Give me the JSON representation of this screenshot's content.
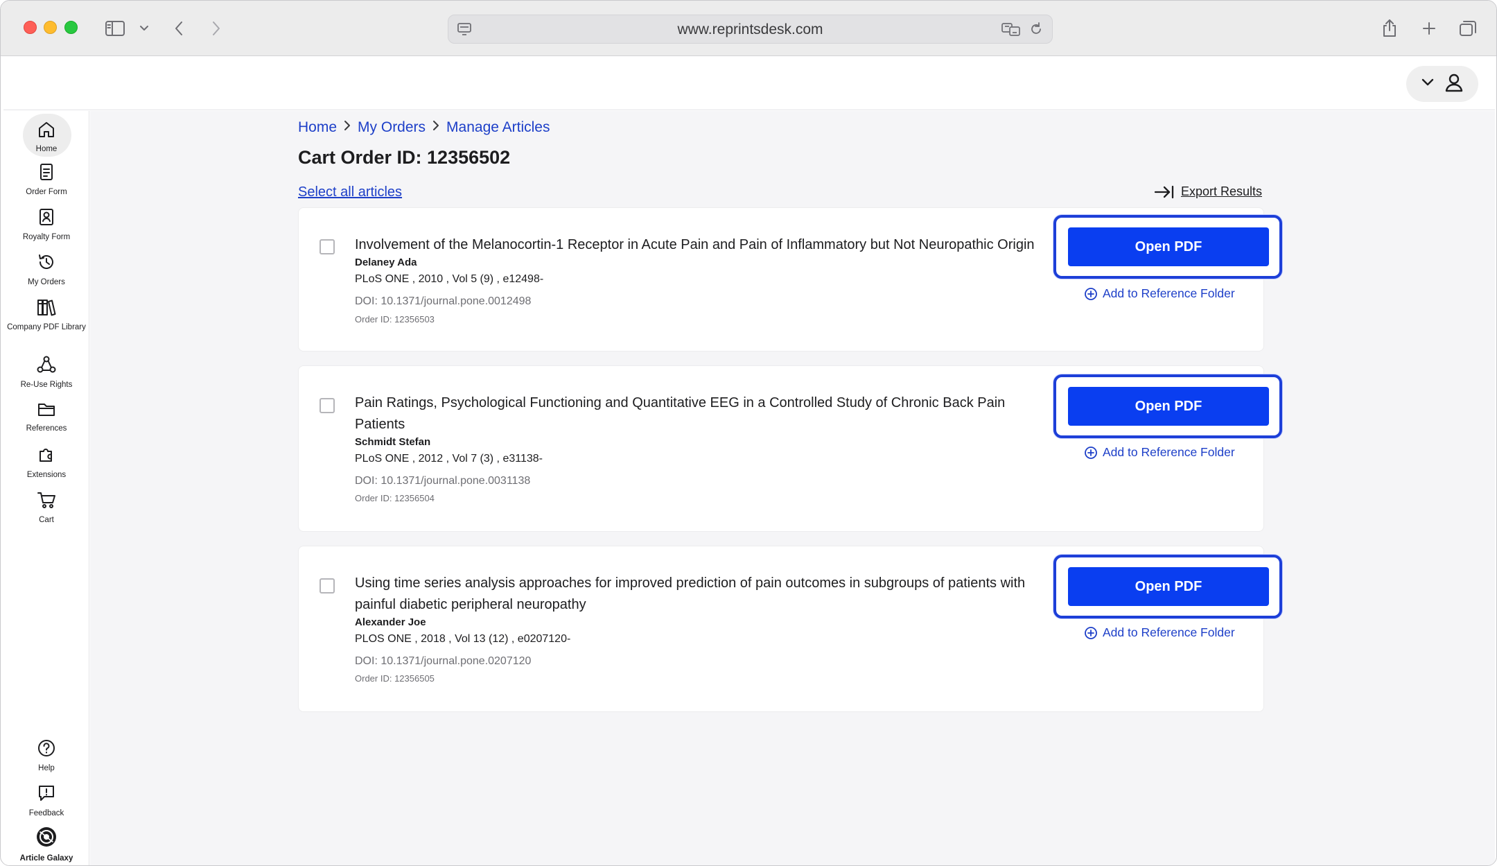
{
  "browser": {
    "url": "www.reprintsdesk.com"
  },
  "sidebar": {
    "items": [
      {
        "label": "Home",
        "icon": "home-icon"
      },
      {
        "label": "Order Form",
        "icon": "document-icon"
      },
      {
        "label": "Royalty Form",
        "icon": "royalty-form-icon"
      },
      {
        "label": "My Orders",
        "icon": "history-icon"
      },
      {
        "label": "Company PDF Library",
        "icon": "library-icon"
      },
      {
        "label": "Re-Use Rights",
        "icon": "share-network-icon"
      },
      {
        "label": "References",
        "icon": "folder-icon"
      },
      {
        "label": "Extensions",
        "icon": "extensions-icon"
      },
      {
        "label": "Cart",
        "icon": "cart-icon"
      }
    ],
    "bottom": [
      {
        "label": "Help",
        "icon": "help-icon"
      },
      {
        "label": "Feedback",
        "icon": "feedback-icon"
      },
      {
        "label": "Article Galaxy",
        "icon": "article-galaxy-logo-icon"
      }
    ]
  },
  "breadcrumb": [
    "Home",
    "My Orders",
    "Manage Articles"
  ],
  "page": {
    "title": "Cart Order ID: 12356502",
    "select_all": "Select all articles",
    "export": "Export Results"
  },
  "articles": [
    {
      "title": "Involvement of the Melanocortin-1 Receptor in Acute Pain and Pain of Inflammatory but Not Neuropathic Origin",
      "author": "Delaney Ada",
      "journal": "PLoS ONE , 2010 , Vol 5 (9) , e12498-",
      "doi": "DOI: 10.1371/journal.pone.0012498",
      "order_id": "Order ID: 12356503",
      "button": "Open PDF",
      "ref_link": "Add to Reference Folder"
    },
    {
      "title": "Pain Ratings, Psychological Functioning and Quantitative EEG in a Controlled Study of Chronic Back Pain Patients",
      "author": "Schmidt Stefan",
      "journal": "PLoS ONE , 2012 , Vol 7 (3) , e31138-",
      "doi": "DOI: 10.1371/journal.pone.0031138",
      "order_id": "Order ID: 12356504",
      "button": "Open PDF",
      "ref_link": "Add to Reference Folder"
    },
    {
      "title": "Using time series analysis approaches for improved prediction of pain outcomes in subgroups of patients with painful diabetic peripheral neuropathy",
      "author": "Alexander Joe",
      "journal": "PLOS ONE , 2018 , Vol 13 (12) , e0207120-",
      "doi": "DOI: 10.1371/journal.pone.0207120",
      "order_id": "Order ID: 12356505",
      "button": "Open PDF",
      "ref_link": "Add to Reference Folder"
    }
  ],
  "colors": {
    "accent": "#0a3ef0",
    "link": "#1d3fc8",
    "highlight_border": "#1d3fd8"
  }
}
